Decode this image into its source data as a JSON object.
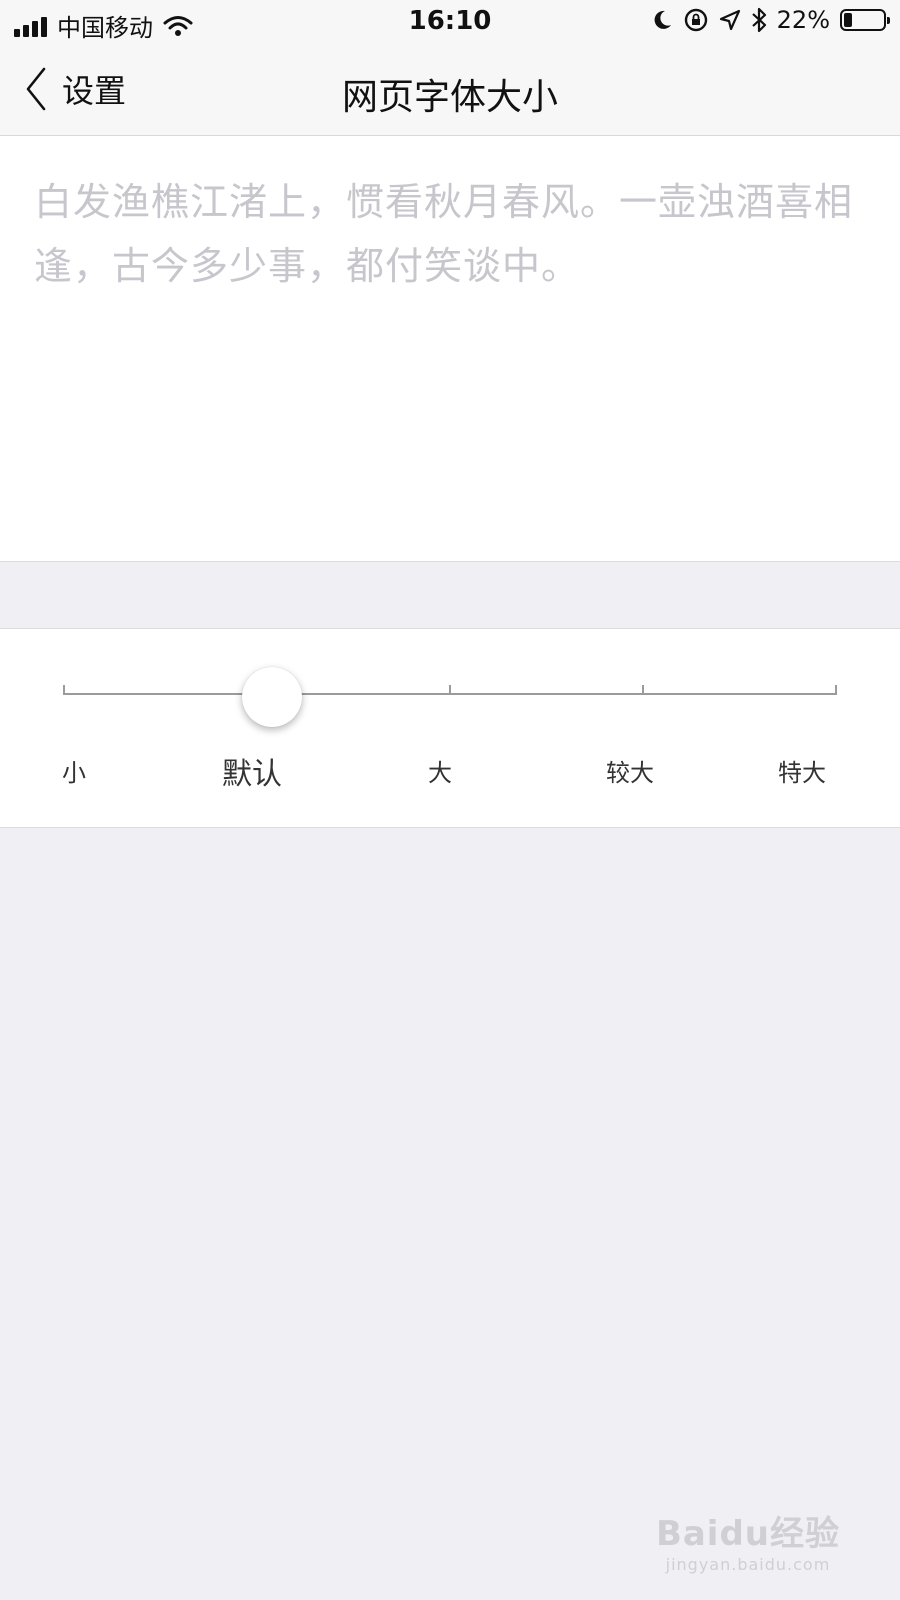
{
  "status_bar": {
    "carrier": "中国移动",
    "time": "16:10",
    "battery_percent": "22%",
    "battery_level": 0.22,
    "icons": [
      "signal-icon",
      "wifi-icon",
      "moon-icon",
      "rotation-lock-icon",
      "location-icon",
      "bluetooth-icon",
      "battery-icon"
    ]
  },
  "nav": {
    "back_label": "设置",
    "title": "网页字体大小"
  },
  "preview": {
    "text": "白发渔樵江渚上，惯看秋月春风。一壶浊酒喜相逢，古今多少事，都付笑谈中。"
  },
  "font_size": {
    "options": [
      {
        "label": "小"
      },
      {
        "label": "默认"
      },
      {
        "label": "大"
      },
      {
        "label": "较大"
      },
      {
        "label": "特大"
      }
    ],
    "selected_index": 1
  },
  "watermark": {
    "brand": "Baidu经验",
    "url": "jingyan.baidu.com"
  }
}
